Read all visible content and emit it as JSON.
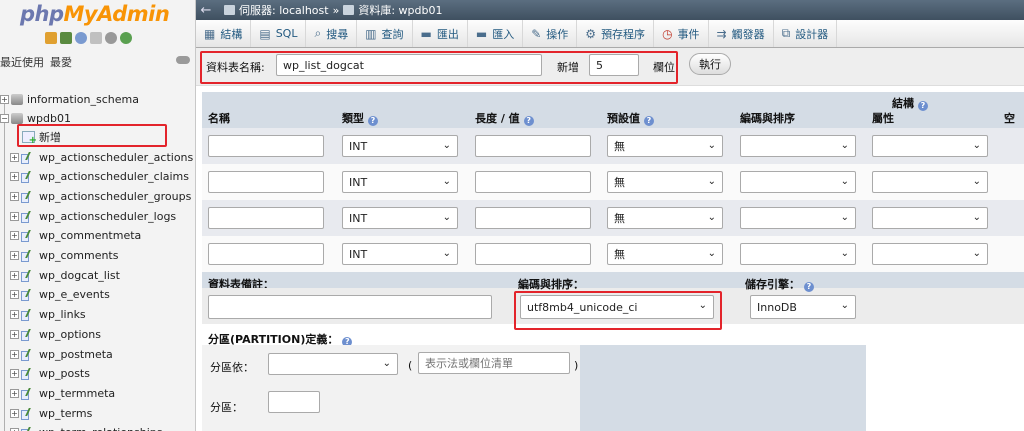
{
  "sidebar": {
    "logo_php": "php",
    "logo_myadmin": "MyAdmin",
    "recent_label": "最近使用",
    "favorites_label": "最愛",
    "databases": [
      {
        "name": "information_schema"
      },
      {
        "name": "wpdb01"
      }
    ],
    "new_label": "新增",
    "tables": [
      "wp_actionscheduler_actions",
      "wp_actionscheduler_claims",
      "wp_actionscheduler_groups",
      "wp_actionscheduler_logs",
      "wp_commentmeta",
      "wp_comments",
      "wp_dogcat_list",
      "wp_e_events",
      "wp_links",
      "wp_options",
      "wp_postmeta",
      "wp_posts",
      "wp_termmeta",
      "wp_terms",
      "wp_term_relationships"
    ]
  },
  "breadcrumb": {
    "server_label": "伺服器: localhost",
    "separator": "»",
    "db_label": "資料庫: wpdb01"
  },
  "tabs": [
    {
      "label": "結構",
      "icon": "structure-icon"
    },
    {
      "label": "SQL",
      "icon": "sql-icon"
    },
    {
      "label": "搜尋",
      "icon": "search-icon"
    },
    {
      "label": "查詢",
      "icon": "query-icon"
    },
    {
      "label": "匯出",
      "icon": "export-icon"
    },
    {
      "label": "匯入",
      "icon": "import-icon"
    },
    {
      "label": "操作",
      "icon": "wrench-icon"
    },
    {
      "label": "預存程序",
      "icon": "routines-icon"
    },
    {
      "label": "事件",
      "icon": "clock-icon"
    },
    {
      "label": "觸發器",
      "icon": "triggers-icon"
    },
    {
      "label": "設計器",
      "icon": "designer-icon"
    }
  ],
  "table_name_bar": {
    "label": "資料表名稱:",
    "value": "wp_list_dogcat",
    "add_label": "新增",
    "add_value": "5",
    "columns_label": "欄位",
    "go_button": "執行"
  },
  "columns": {
    "structure_title": "結構",
    "headers": {
      "name": "名稱",
      "type": "類型",
      "length": "長度 / 值",
      "default": "預設值",
      "collation": "編碼與排序",
      "attributes": "屬性",
      "null": "空值"
    },
    "rows": [
      {
        "name": "",
        "type": "INT",
        "length": "",
        "default": "無",
        "collation": "",
        "attributes": ""
      },
      {
        "name": "",
        "type": "INT",
        "length": "",
        "default": "無",
        "collation": "",
        "attributes": ""
      },
      {
        "name": "",
        "type": "INT",
        "length": "",
        "default": "無",
        "collation": "",
        "attributes": ""
      },
      {
        "name": "",
        "type": "INT",
        "length": "",
        "default": "無",
        "collation": "",
        "attributes": ""
      }
    ]
  },
  "table_options": {
    "comment_label": "資料表備註：",
    "comment_value": "",
    "collation_label": "編碼與排序：",
    "collation_value": "utf8mb4_unicode_ci",
    "engine_label": "儲存引擎：",
    "engine_value": "InnoDB"
  },
  "partition": {
    "title": "分區(PARTITION)定義：",
    "by_label": "分區依：",
    "by_value": "",
    "open_paren": "(",
    "expr_placeholder": "表示法或欄位清單",
    "close_paren": ")",
    "partitions_label": "分區：",
    "partitions_value": ""
  },
  "colors": {
    "logo_php": "#6c78af",
    "logo_myadmin": "#f89406",
    "highlight_box": "#e3242b",
    "tab_text": "#235a81"
  }
}
